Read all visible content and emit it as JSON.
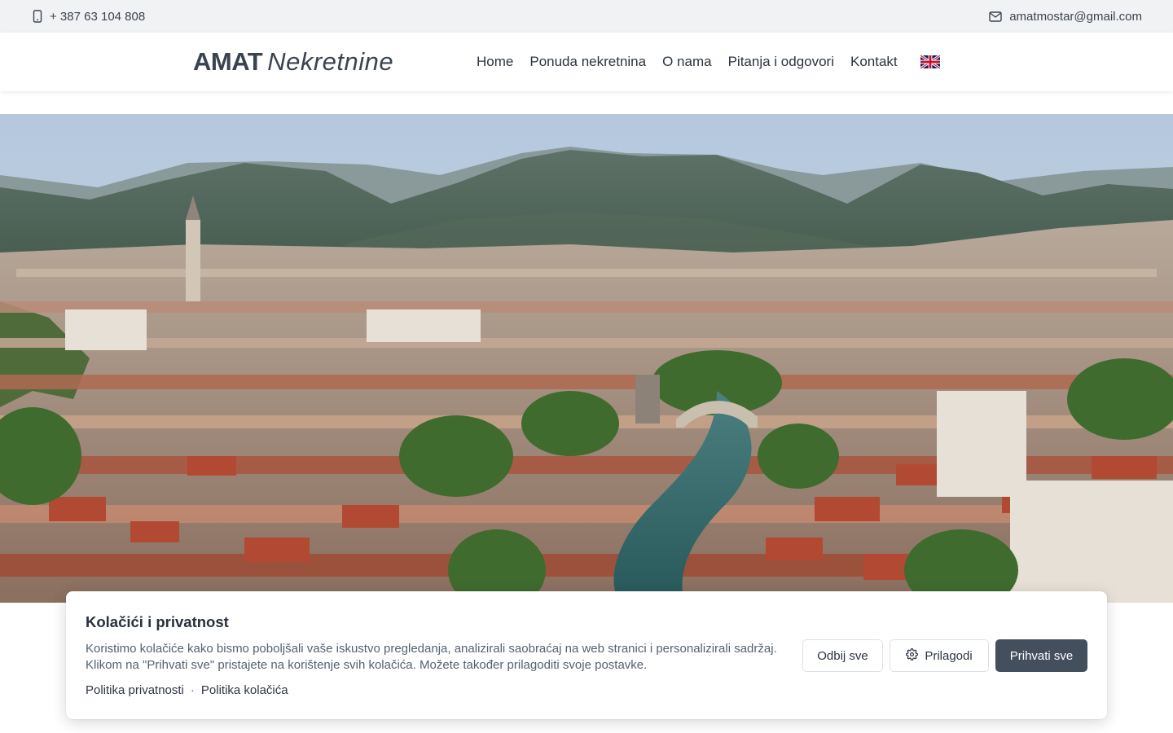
{
  "topbar": {
    "phone": "+ 387 63 104 808",
    "phone_icon": "mobile-phone-icon",
    "email": "amatmostar@gmail.com",
    "email_icon": "envelope-icon"
  },
  "header": {
    "logo_bold": "AMAT",
    "logo_italic": "Nekretnine",
    "nav": [
      {
        "label": "Home"
      },
      {
        "label": "Ponuda nekretnina"
      },
      {
        "label": "O nama"
      },
      {
        "label": "Pitanja i odgovori"
      },
      {
        "label": "Kontakt"
      }
    ],
    "language_icon": "uk-flag-icon"
  },
  "hero": {
    "image": "aerial-panorama-mostar-old-bridge"
  },
  "cookie_banner": {
    "title": "Kolačići i privatnost",
    "text": "Koristimo kolačiće kako bismo poboljšali vaše iskustvo pregledanja, analizirali saobraćaj na web stranici i personalizirali sadržaj. Klikom na \"Prihvati sve\" pristajete na korištenje svih kolačića. Možete također prilagoditi svoje postavke.",
    "links": [
      "Politika privatnosti",
      "Politika kolačića"
    ],
    "link_separator": "·",
    "buttons": {
      "reject": "Odbij sve",
      "customize": "Prilagodi",
      "customize_icon": "gear-icon",
      "accept": "Prihvati sve"
    }
  },
  "colors": {
    "topbar_bg": "#f1f2f4",
    "text": "#2b3440",
    "primary_button": "#444f5e"
  }
}
